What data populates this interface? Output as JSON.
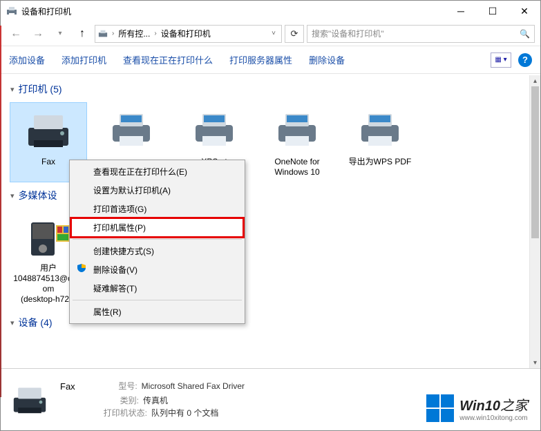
{
  "title": "设备和打印机",
  "breadcrumb": {
    "root": "所有控...",
    "current": "设备和打印机"
  },
  "search_placeholder": "搜索\"设备和打印机\"",
  "toolbar": {
    "add_device": "添加设备",
    "add_printer": "添加打印机",
    "see_printing": "查看现在正在打印什么",
    "server_props": "打印服务器属性",
    "remove_device": "删除设备"
  },
  "groups": {
    "printers": {
      "label": "打印机",
      "count": 5
    },
    "multimedia": {
      "label": "多媒体设"
    },
    "devices": {
      "label": "设备",
      "count": 4
    }
  },
  "printers": [
    {
      "label": "Fax"
    },
    {
      "label": ""
    },
    {
      "label": "XPS nt"
    },
    {
      "label": "OneNote for Windows 10"
    },
    {
      "label": "导出为WPS PDF"
    }
  ],
  "multimedia": [
    {
      "l1": "用户",
      "l2": "1048874513@qq.com",
      "l3": "(desktop-h72..."
    }
  ],
  "context_menu": {
    "see_printing": "查看现在正在打印什么(E)",
    "set_default": "设置为默认打印机(A)",
    "preferences": "打印首选项(G)",
    "printer_props": "打印机属性(P)",
    "create_shortcut": "创建快捷方式(S)",
    "remove": "删除设备(V)",
    "troubleshoot": "疑难解答(T)",
    "properties": "属性(R)"
  },
  "details": {
    "name": "Fax",
    "model_label": "型号:",
    "model_value": "Microsoft Shared Fax Driver",
    "category_label": "类别:",
    "category_value": "传真机",
    "status_label": "打印机状态:",
    "status_value": "队列中有 0 个文档"
  },
  "watermark": {
    "brand": "Win10",
    "suffix": "之家",
    "url": "www.win10xitong.com"
  }
}
